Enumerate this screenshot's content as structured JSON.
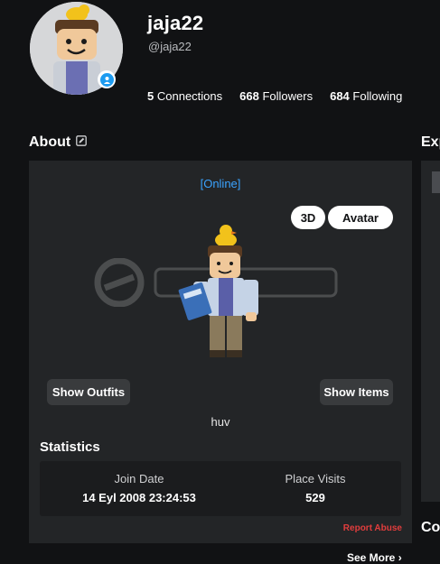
{
  "profile": {
    "username": "jaja22",
    "handle": "@jaja22",
    "stats": {
      "connections_count": "5",
      "connections_label": "Connections",
      "followers_count": "668",
      "followers_label": "Followers",
      "following_count": "684",
      "following_label": "Following"
    }
  },
  "about": {
    "heading": "About",
    "status": "[Online]",
    "view_3d_label": "3D",
    "view_avatar_label": "Avatar",
    "show_outfits_label": "Show Outfits",
    "show_items_label": "Show Items",
    "bio": "huv",
    "statistics_heading": "Statistics",
    "join_date_label": "Join Date",
    "join_date_value": "14 Eyl 2008 23:24:53",
    "place_visits_label": "Place Visits",
    "place_visits_value": "529",
    "report_label": "Report Abuse",
    "see_more_label": "See More"
  },
  "side": {
    "experiences_heading": "Exp",
    "connections_heading": "Co"
  },
  "colors": {
    "background": "#111214",
    "card": "#232527",
    "accent": "#3aa3ff",
    "danger": "#e23d3d"
  },
  "icons": [
    "edit-icon",
    "chevron-right-icon",
    "presence-icon"
  ]
}
